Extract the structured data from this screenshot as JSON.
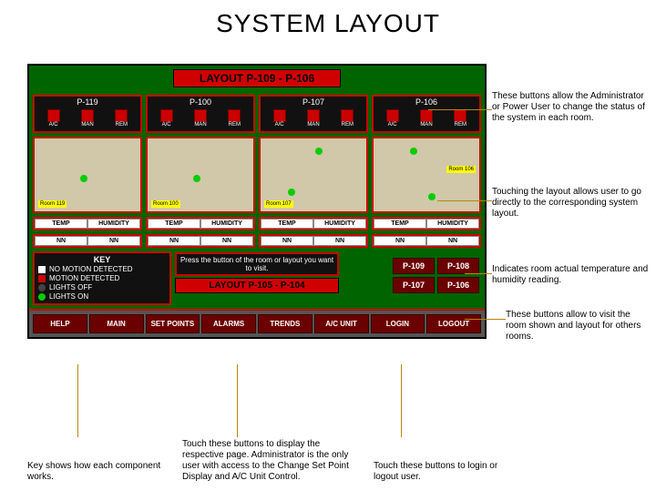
{
  "title": "SYSTEM LAYOUT",
  "panel": {
    "header": "LAYOUT P-109 - P-106",
    "rooms": [
      "P-119",
      "P-100",
      "P-107",
      "P-106"
    ],
    "controls": [
      "A/C",
      "MAN",
      "REM"
    ],
    "th": {
      "temp": "TEMP",
      "hum": "HUMIDITY",
      "tv": "NN",
      "hv": "NN"
    },
    "key": {
      "title": "KEY",
      "i1": "NO MOTION DETECTED",
      "i2": "MOTION DETECTED",
      "i3": "LIGHTS OFF",
      "i4": "LIGHTS ON"
    },
    "hint": "Press the button of the room or layout you want to visit.",
    "header2": "LAYOUT P-105 - P-104",
    "pbtns": [
      "P-109",
      "P-108",
      "P-107",
      "P-106"
    ],
    "nav": [
      "HELP",
      "MAIN",
      "SET POINTS",
      "ALARMS",
      "TRENDS",
      "A/C UNIT",
      "LOGIN",
      "LOGOUT"
    ]
  },
  "ann": {
    "a1": "These buttons allow the Administrator or Power User to change the status of the system in each room.",
    "a2": "Touching the layout allows user to go directly to the corresponding system layout.",
    "a3": "Indicates room actual temperature and humidity reading.",
    "a4": "These buttons allow to visit the room shown and layout for others rooms."
  },
  "cap": {
    "c1": "Key shows how each component works.",
    "c2": "Touch these buttons to display the respective page. Administrator is the only user with access to the Change Set Point Display and A/C Unit Control.",
    "c3": "Touch these buttons to login or logout user."
  }
}
